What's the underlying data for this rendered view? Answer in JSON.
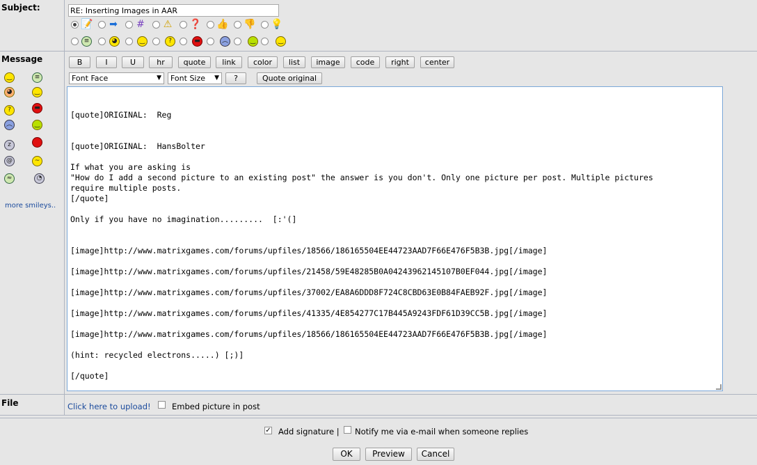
{
  "labels": {
    "subject": "Subject:",
    "message": "Message",
    "file": "File"
  },
  "subject": {
    "value": "RE: Inserting Images in AAR"
  },
  "post_icons_row1": [
    "note-icon",
    "arrow-right-icon",
    "hash-icon",
    "warning-icon",
    "question-icon",
    "thumbs-up-icon",
    "thumbs-down-icon",
    "lightbulb-icon"
  ],
  "post_icons_row2": [
    "grin-smiley",
    "cool-smiley",
    "smile-smiley",
    "confused-smiley",
    "angry-smiley",
    "sad-smiley",
    "happy-smiley",
    "smile-smiley-2"
  ],
  "sidebar_smileys": {
    "more_link": "more smileys.."
  },
  "toolbar": {
    "buttons": [
      "B",
      "I",
      "U",
      "hr",
      "quote",
      "link",
      "color",
      "list",
      "image",
      "code",
      "right",
      "center"
    ],
    "font_face": "Font Face",
    "font_size": "Font Size",
    "help": "?",
    "quote_original": "Quote original"
  },
  "message": {
    "text": "\n[quote]ORIGINAL:  Reg\n\n\n[quote]ORIGINAL:  HansBolter\n\nIf what you are asking is\n\"How do I add a second picture to an existing post\" the answer is you don't. Only one picture per post. Multiple pictures\nrequire multiple posts.\n[/quote]\n\nOnly if you have no imagination.........  [:'(]\n\n\n[image]http://www.matrixgames.com/forums/upfiles/18566/186165504EE44723AAD7F66E476F5B3B.jpg[/image]\n\n[image]http://www.matrixgames.com/forums/upfiles/21458/59E48285B0A04243962145107B0EF044.jpg[/image]\n\n[image]http://www.matrixgames.com/forums/upfiles/37002/EA8A6DDD8F724C8CBD63E0B84FAEB92F.jpg[/image]\n\n[image]http://www.matrixgames.com/forums/upfiles/41335/4E854277C17B445A9243FDF61D39CC5B.jpg[/image]\n\n[image]http://www.matrixgames.com/forums/upfiles/18566/186165504EE44723AAD7F66E476F5B3B.jpg[/image]\n\n(hint: recycled electrons.....) [;)]\n\n[/quote]"
  },
  "file": {
    "upload_link": "Click here to upload!",
    "embed_label": "Embed picture in post"
  },
  "options": {
    "add_signature": "Add signature |",
    "notify": "Notify me via e-mail when someone replies"
  },
  "actions": {
    "ok": "OK",
    "preview": "Preview",
    "cancel": "Cancel"
  }
}
